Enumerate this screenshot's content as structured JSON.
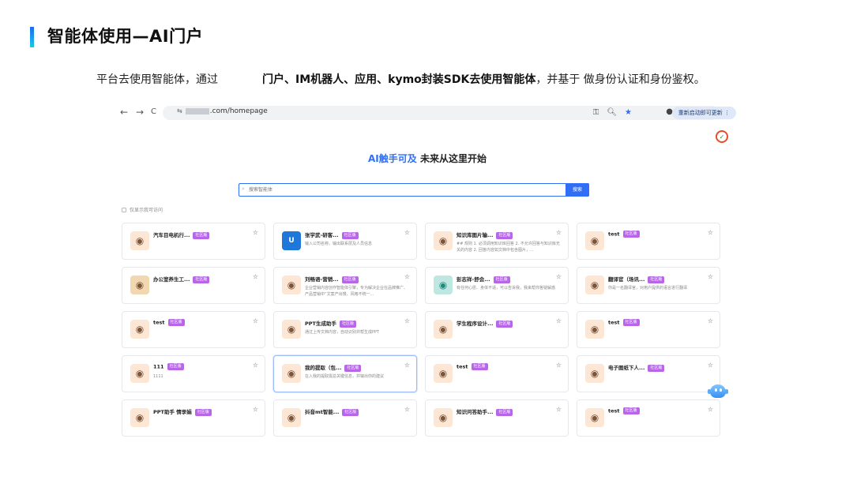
{
  "slide": {
    "title": "智能体使用—AI门户",
    "subtitle_left": "平台去使用智能体，通过",
    "subtitle_bold": "门户、IM机器人、应用、kymo封装SDK去使用智能体",
    "subtitle_right": "，并基于 做身份认证和身份鉴权。"
  },
  "browser": {
    "back": "←",
    "forward": "→",
    "reload": "C",
    "site_info": "⇆",
    "url_suffix": ".com/homepage",
    "restart_label": "重新启动即可更新",
    "menu": "⋮"
  },
  "page": {
    "hero_accent": "AI触手可及",
    "hero_rest": " 未来从这里开始",
    "search_placeholder": "搜索智能体",
    "search_button": "搜索",
    "only_visible_label": "仅显示我可访问"
  },
  "cards": [
    {
      "title": "汽车目电机行...",
      "tag": "社区版",
      "desc": "",
      "icon": "robot-icon",
      "style": ""
    },
    {
      "title": "张学武-研客...",
      "tag": "社区版",
      "desc": "输入公司名称，输出联系层及人员信息",
      "icon": "logo-icon",
      "style": "blue",
      "glyph": "U"
    },
    {
      "title": "知识库图片输...",
      "tag": "社区版",
      "desc": "## 规则 1. 必须调用知识库回答 2. 不允许回答与知识库无关的内容 2. 回答内容如文档中包含图片，...",
      "icon": "robot-icon",
      "style": ""
    },
    {
      "title": "test",
      "tag": "社区版",
      "desc": "",
      "icon": "robot-icon",
      "style": ""
    },
    {
      "title": "办公室养生工...",
      "tag": "社区版",
      "desc": "",
      "icon": "robot-icon",
      "style": "deep"
    },
    {
      "title": "刘畅语-营销...",
      "tag": "社区版",
      "desc": "企业营销内容创作智能体引擎，专为解决企业在品牌推广、产品营销中“文案产出慢、风格不统一...",
      "icon": "robot-icon",
      "style": ""
    },
    {
      "title": "彭志祥-舒会...",
      "tag": "社区版",
      "desc": "有任何心愿、身体不适，可以告诉我，我来帮你答疑解惑",
      "icon": "robot-icon",
      "style": "teal"
    },
    {
      "title": "翻译官（场讯...",
      "tag": "社区版",
      "desc": "你是一名翻译官，对用户提供的语言进行翻译",
      "icon": "robot-icon",
      "style": ""
    },
    {
      "title": "test",
      "tag": "社区版",
      "desc": "",
      "icon": "robot-icon",
      "style": ""
    },
    {
      "title": "PPT生成助手",
      "tag": "社区版",
      "desc": "通过上传文档内容，自动识别并帮生成PPT",
      "icon": "robot-icon",
      "style": ""
    },
    {
      "title": "学生程序设计...",
      "tag": "社区版",
      "desc": "",
      "icon": "robot-icon",
      "style": ""
    },
    {
      "title": "test",
      "tag": "社区版",
      "desc": "",
      "icon": "robot-icon",
      "style": ""
    },
    {
      "title": "111",
      "tag": "社区版",
      "desc": "1111",
      "icon": "robot-icon",
      "style": ""
    },
    {
      "title": "我的提取（包...",
      "tag": "社区版",
      "desc": "在入我的提取需总关键信息，并输出你的建议",
      "icon": "robot-icon",
      "style": "",
      "highlight": true
    },
    {
      "title": "test",
      "tag": "社区版",
      "desc": "",
      "icon": "robot-icon",
      "style": ""
    },
    {
      "title": "电子图纸下人...",
      "tag": "社区版",
      "desc": "",
      "icon": "robot-icon",
      "style": ""
    },
    {
      "title": "PPT助手 情李娟",
      "tag": "社区版",
      "desc": "",
      "icon": "robot-icon",
      "style": ""
    },
    {
      "title": "抖音mt智能...",
      "tag": "社区版",
      "desc": "",
      "icon": "robot-icon",
      "style": ""
    },
    {
      "title": "知识问答助手...",
      "tag": "社区版",
      "desc": "",
      "icon": "robot-icon",
      "style": ""
    },
    {
      "title": "test",
      "tag": "社区版",
      "desc": "",
      "icon": "robot-icon",
      "style": ""
    }
  ],
  "colors": {
    "accent": "#2f6ef5",
    "tag": "#b865e8"
  }
}
